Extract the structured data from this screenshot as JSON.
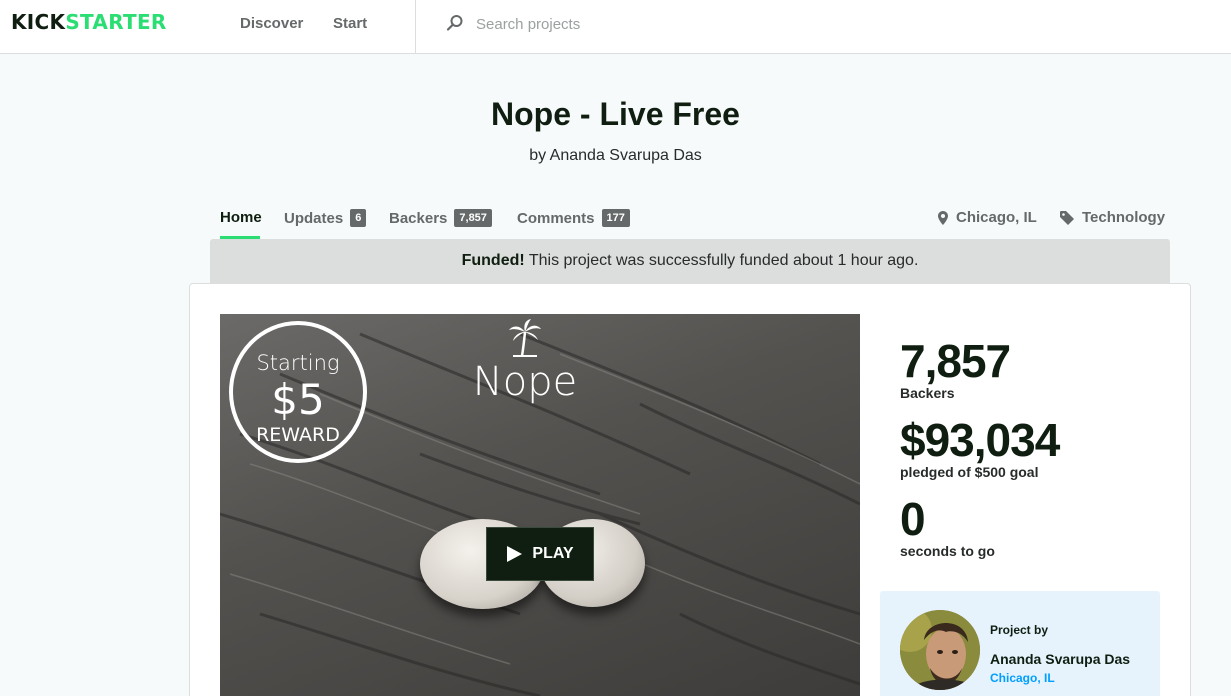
{
  "header": {
    "logo_part1": "KICK",
    "logo_part2": "STARTER",
    "nav": [
      "Discover",
      "Start"
    ],
    "search_placeholder": "Search projects"
  },
  "project": {
    "title": "Nope - Live Free",
    "byline": "by Ananda Svarupa Das"
  },
  "tabs": [
    {
      "label": "Home",
      "active": true
    },
    {
      "label": "Updates",
      "count": "6"
    },
    {
      "label": "Backers",
      "count": "7,857"
    },
    {
      "label": "Comments",
      "count": "177"
    }
  ],
  "meta": {
    "location": "Chicago, IL",
    "category": "Technology"
  },
  "banner": {
    "strong": "Funded!",
    "text": " This project was successfully funded about 1 hour ago."
  },
  "video": {
    "reward_line1": "Starting",
    "reward_line2": "$5",
    "reward_line3": "REWARD",
    "brand": "Nope",
    "play_label": "PLAY"
  },
  "stats": {
    "backers_value": "7,857",
    "backers_label": "Backers",
    "pledged_value": "$93,034",
    "pledged_label": "pledged of $500 goal",
    "time_value": "0",
    "time_label": "seconds to go"
  },
  "creator": {
    "project_by": "Project by",
    "name": "Ananda Svarupa Das",
    "location": "Chicago, IL"
  },
  "colors": {
    "accent": "#2bde73",
    "dark": "#0f1e10",
    "link": "#009eff"
  }
}
